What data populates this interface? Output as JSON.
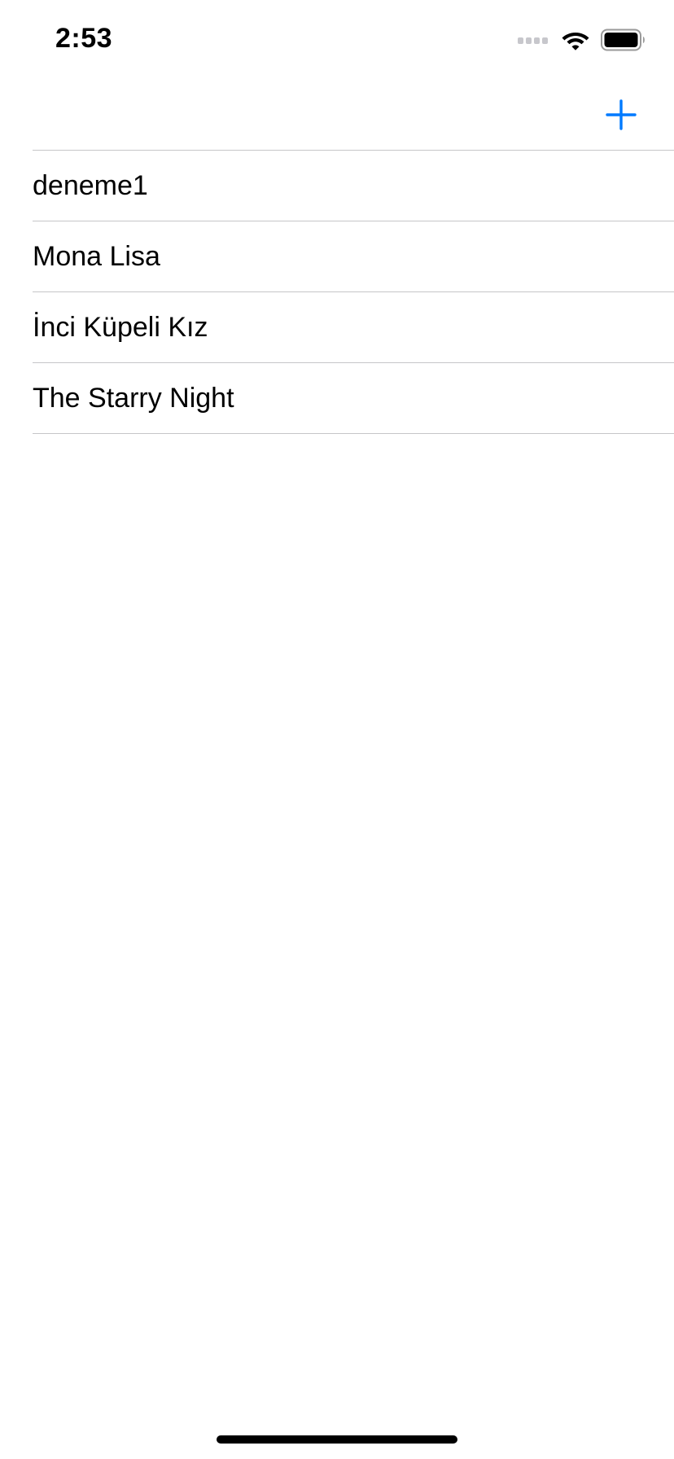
{
  "status_bar": {
    "time": "2:53",
    "icons": [
      "signal-icon",
      "wifi-icon",
      "battery-icon"
    ]
  },
  "nav_bar": {
    "add_button_icon": "plus-icon",
    "accent_color": "#007aff"
  },
  "list": {
    "items": [
      {
        "label": "deneme1"
      },
      {
        "label": "Mona Lisa"
      },
      {
        "label": "İnci Küpeli Kız"
      },
      {
        "label": "The Starry Night"
      }
    ]
  }
}
